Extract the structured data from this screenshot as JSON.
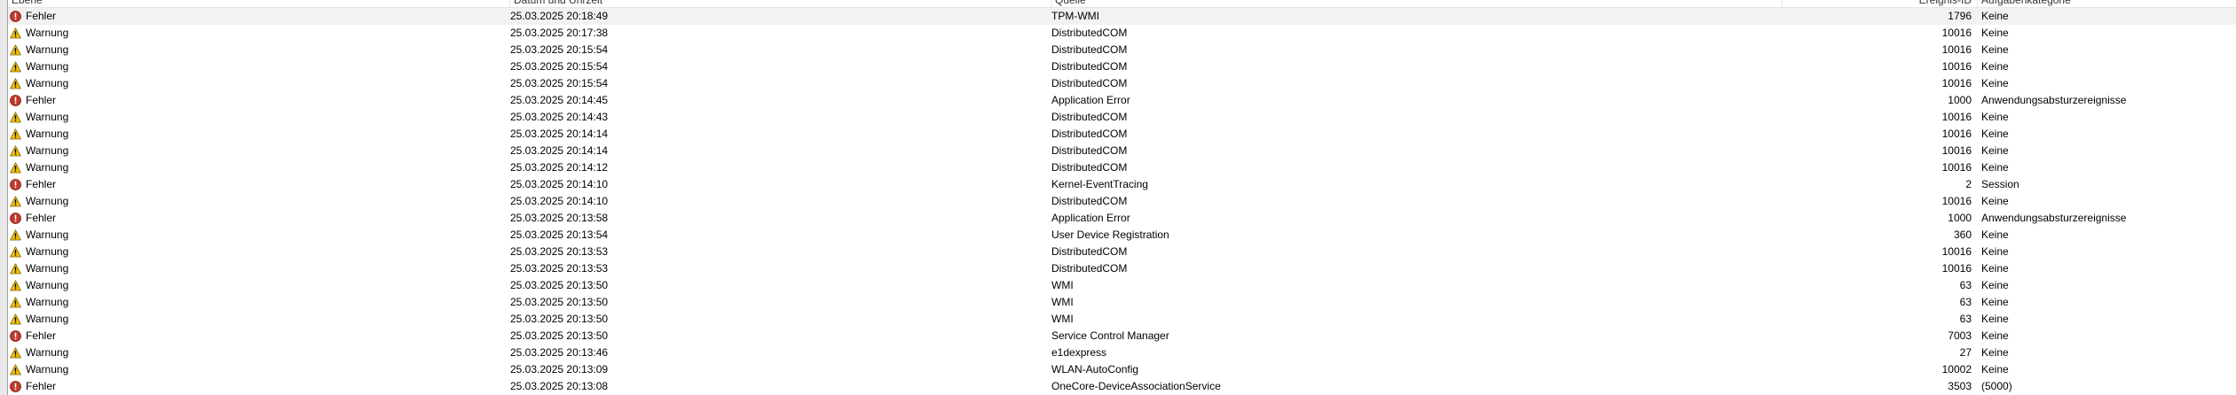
{
  "columns": {
    "level": "Ebene",
    "date": "Datum und Uhrzeit",
    "source": "Quelle",
    "event_id": "Ereignis-ID",
    "category": "Aufgabenkategorie"
  },
  "colors": {
    "error": "#c0392b",
    "warning": "#f2c200",
    "selected_row": "#f2f2f2"
  },
  "icons": {
    "error": "error-icon",
    "warning": "warning-icon"
  },
  "rows": [
    {
      "type": "error",
      "level": "Fehler",
      "date": "25.03.2025 20:18:49",
      "source": "TPM-WMI",
      "id": "1796",
      "category": "Keine"
    },
    {
      "type": "warning",
      "level": "Warnung",
      "date": "25.03.2025 20:17:38",
      "source": "DistributedCOM",
      "id": "10016",
      "category": "Keine"
    },
    {
      "type": "warning",
      "level": "Warnung",
      "date": "25.03.2025 20:15:54",
      "source": "DistributedCOM",
      "id": "10016",
      "category": "Keine"
    },
    {
      "type": "warning",
      "level": "Warnung",
      "date": "25.03.2025 20:15:54",
      "source": "DistributedCOM",
      "id": "10016",
      "category": "Keine"
    },
    {
      "type": "warning",
      "level": "Warnung",
      "date": "25.03.2025 20:15:54",
      "source": "DistributedCOM",
      "id": "10016",
      "category": "Keine"
    },
    {
      "type": "error",
      "level": "Fehler",
      "date": "25.03.2025 20:14:45",
      "source": "Application Error",
      "id": "1000",
      "category": "Anwendungsabsturzereignisse"
    },
    {
      "type": "warning",
      "level": "Warnung",
      "date": "25.03.2025 20:14:43",
      "source": "DistributedCOM",
      "id": "10016",
      "category": "Keine"
    },
    {
      "type": "warning",
      "level": "Warnung",
      "date": "25.03.2025 20:14:14",
      "source": "DistributedCOM",
      "id": "10016",
      "category": "Keine"
    },
    {
      "type": "warning",
      "level": "Warnung",
      "date": "25.03.2025 20:14:14",
      "source": "DistributedCOM",
      "id": "10016",
      "category": "Keine"
    },
    {
      "type": "warning",
      "level": "Warnung",
      "date": "25.03.2025 20:14:12",
      "source": "DistributedCOM",
      "id": "10016",
      "category": "Keine"
    },
    {
      "type": "error",
      "level": "Fehler",
      "date": "25.03.2025 20:14:10",
      "source": "Kernel-EventTracing",
      "id": "2",
      "category": "Session"
    },
    {
      "type": "warning",
      "level": "Warnung",
      "date": "25.03.2025 20:14:10",
      "source": "DistributedCOM",
      "id": "10016",
      "category": "Keine"
    },
    {
      "type": "error",
      "level": "Fehler",
      "date": "25.03.2025 20:13:58",
      "source": "Application Error",
      "id": "1000",
      "category": "Anwendungsabsturzereignisse"
    },
    {
      "type": "warning",
      "level": "Warnung",
      "date": "25.03.2025 20:13:54",
      "source": "User Device Registration",
      "id": "360",
      "category": "Keine"
    },
    {
      "type": "warning",
      "level": "Warnung",
      "date": "25.03.2025 20:13:53",
      "source": "DistributedCOM",
      "id": "10016",
      "category": "Keine"
    },
    {
      "type": "warning",
      "level": "Warnung",
      "date": "25.03.2025 20:13:53",
      "source": "DistributedCOM",
      "id": "10016",
      "category": "Keine"
    },
    {
      "type": "warning",
      "level": "Warnung",
      "date": "25.03.2025 20:13:50",
      "source": "WMI",
      "id": "63",
      "category": "Keine"
    },
    {
      "type": "warning",
      "level": "Warnung",
      "date": "25.03.2025 20:13:50",
      "source": "WMI",
      "id": "63",
      "category": "Keine"
    },
    {
      "type": "warning",
      "level": "Warnung",
      "date": "25.03.2025 20:13:50",
      "source": "WMI",
      "id": "63",
      "category": "Keine"
    },
    {
      "type": "error",
      "level": "Fehler",
      "date": "25.03.2025 20:13:50",
      "source": "Service Control Manager",
      "id": "7003",
      "category": "Keine"
    },
    {
      "type": "warning",
      "level": "Warnung",
      "date": "25.03.2025 20:13:46",
      "source": "e1dexpress",
      "id": "27",
      "category": "Keine"
    },
    {
      "type": "warning",
      "level": "Warnung",
      "date": "25.03.2025 20:13:09",
      "source": "WLAN-AutoConfig",
      "id": "10002",
      "category": "Keine"
    },
    {
      "type": "error",
      "level": "Fehler",
      "date": "25.03.2025 20:13:08",
      "source": "OneCore-DeviceAssociationService",
      "id": "3503",
      "category": "(5000)"
    }
  ]
}
